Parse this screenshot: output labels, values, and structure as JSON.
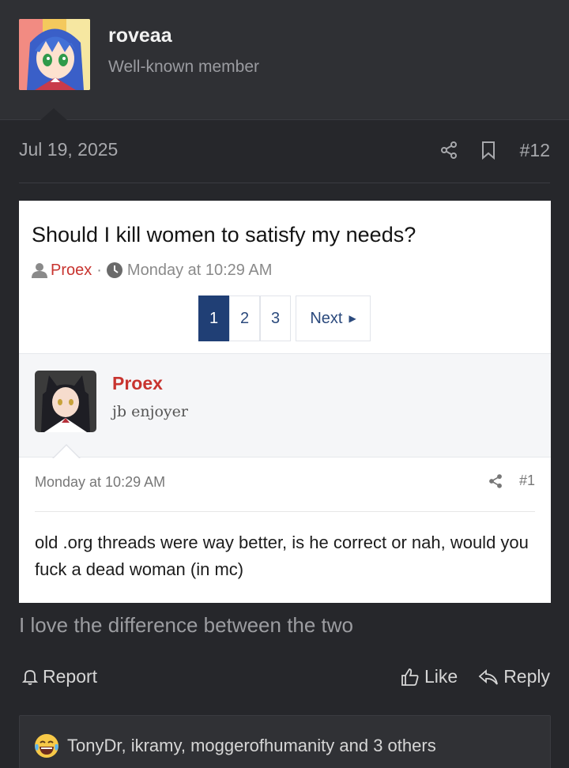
{
  "user": {
    "name": "roveaa",
    "title": "Well-known member"
  },
  "post": {
    "date": "Jul 19, 2025",
    "number": "#12",
    "message": "I love the difference between the two"
  },
  "embed": {
    "title": "Should I kill women to satisfy my needs?",
    "author": "Proex",
    "separator": "·",
    "time": "Monday at 10:29 AM",
    "pages": [
      "1",
      "2",
      "3"
    ],
    "next_label": "Next",
    "user_name": "Proex",
    "user_title": "jb enjoyer",
    "post_date": "Monday at 10:29 AM",
    "post_number": "#1",
    "body": "old .org threads were way better, is he correct or nah, would you fuck a dead woman (in mc)"
  },
  "actions": {
    "report": "Report",
    "like": "Like",
    "reply": "Reply"
  },
  "reactions": {
    "text": "TonyDr, ikramy, moggerofhumanity and 3 others",
    "emoji_icon": "laughing-crying-emoji-icon"
  },
  "colors": {
    "background": "#26272b",
    "header": "#2f3034",
    "accent_red": "#c8342f",
    "pager_active": "#203f75"
  }
}
